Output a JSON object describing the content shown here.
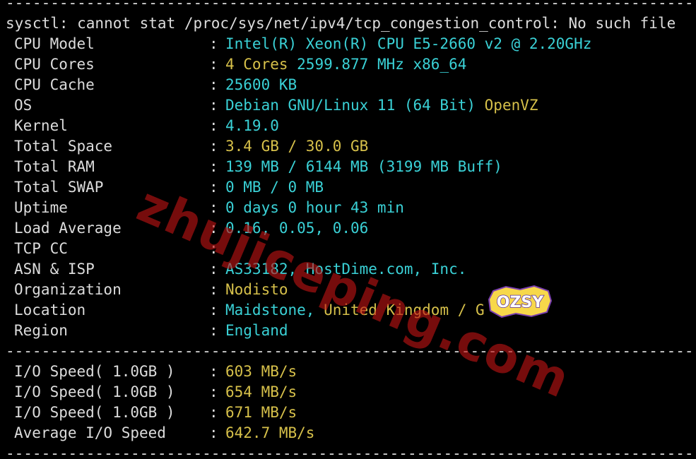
{
  "terminal": {
    "separator": "----------------------------------------------------------------------------------------------------------",
    "error_line": "sysctl: cannot stat /proc/sys/net/ipv4/tcp_congestion_control: No such file",
    "colon": ":",
    "rows": [
      {
        "label": "CPU Model",
        "value": "Intel(R) Xeon(R) CPU E5-2660 v2 @ 2.20GHz"
      },
      {
        "label": "CPU Cores",
        "value_a": "4 Cores",
        "value_b": " 2599.877 MHz x86_64"
      },
      {
        "label": "CPU Cache",
        "value": "25600 KB"
      },
      {
        "label": "OS",
        "value_a": "Debian GNU/Linux 11 (64 Bit)",
        "value_b": " OpenVZ"
      },
      {
        "label": "Kernel",
        "value": "4.19.0"
      },
      {
        "label": "Total Space",
        "value": "3.4 GB / 30.0 GB"
      },
      {
        "label": "Total RAM",
        "value": "139 MB / 6144 MB (3199 MB Buff)"
      },
      {
        "label": "Total SWAP",
        "value": "0 MB / 0 MB"
      },
      {
        "label": "Uptime",
        "value": "0 days 0 hour 43 min"
      },
      {
        "label": "Load Average",
        "value": "0.16, 0.05, 0.06"
      },
      {
        "label": "TCP CC",
        "value": ""
      },
      {
        "label": "ASN & ISP",
        "value": "AS33182, HostDime.com, Inc."
      },
      {
        "label": "Organization",
        "value": "Nodisto"
      },
      {
        "label": "Location",
        "value_a": "Maidstone,",
        "value_b": " United Kingdom / G"
      },
      {
        "label": "Region",
        "value": "England"
      }
    ],
    "io_rows": [
      {
        "label": "I/O Speed( 1.0GB )",
        "value": "603 MB/s"
      },
      {
        "label": "I/O Speed( 1.0GB )",
        "value": "654 MB/s"
      },
      {
        "label": "I/O Speed( 1.0GB )",
        "value": "671 MB/s"
      },
      {
        "label": "Average I/O Speed",
        "value": "642.7 MB/s"
      }
    ]
  },
  "watermark": {
    "text": "zhujiceping.com",
    "badge_text": "OZSY"
  },
  "colors": {
    "background": "#000000",
    "text": "#dcdcdc",
    "cyan": "#3ad1d6",
    "yellow": "#d6c04a",
    "watermark": "#be1414"
  }
}
